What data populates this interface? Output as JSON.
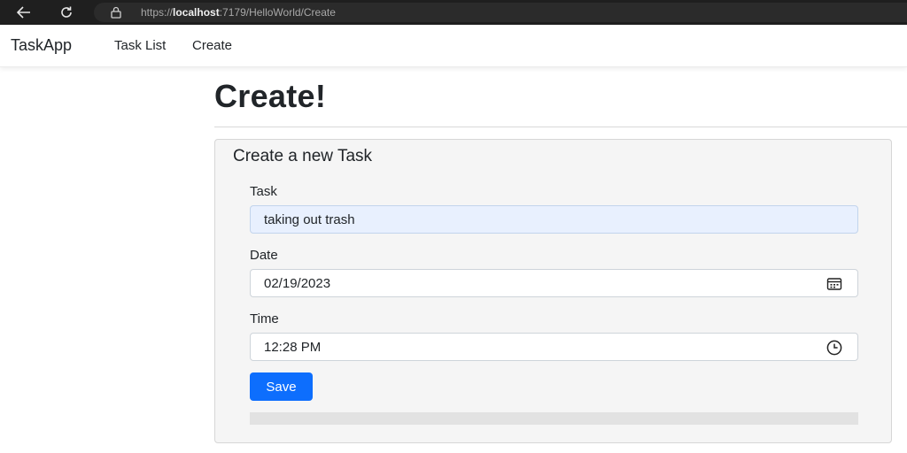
{
  "browser": {
    "url_prefix": "https://",
    "url_host": "localhost",
    "url_rest": ":7179/HelloWorld/Create"
  },
  "navbar": {
    "brand": "TaskApp",
    "links": [
      {
        "label": "Task List"
      },
      {
        "label": "Create"
      }
    ]
  },
  "page": {
    "title": "Create!"
  },
  "form": {
    "heading": "Create a new Task",
    "task": {
      "label": "Task",
      "value": "taking out trash"
    },
    "date": {
      "label": "Date",
      "value": "02/19/2023"
    },
    "time": {
      "label": "Time",
      "value": "12:28 PM"
    },
    "save_label": "Save"
  },
  "colors": {
    "primary": "#0d6efd",
    "autofill": "#e8f0fe",
    "card_bg": "#f5f5f5",
    "browser_bar": "#1f1f1f"
  }
}
